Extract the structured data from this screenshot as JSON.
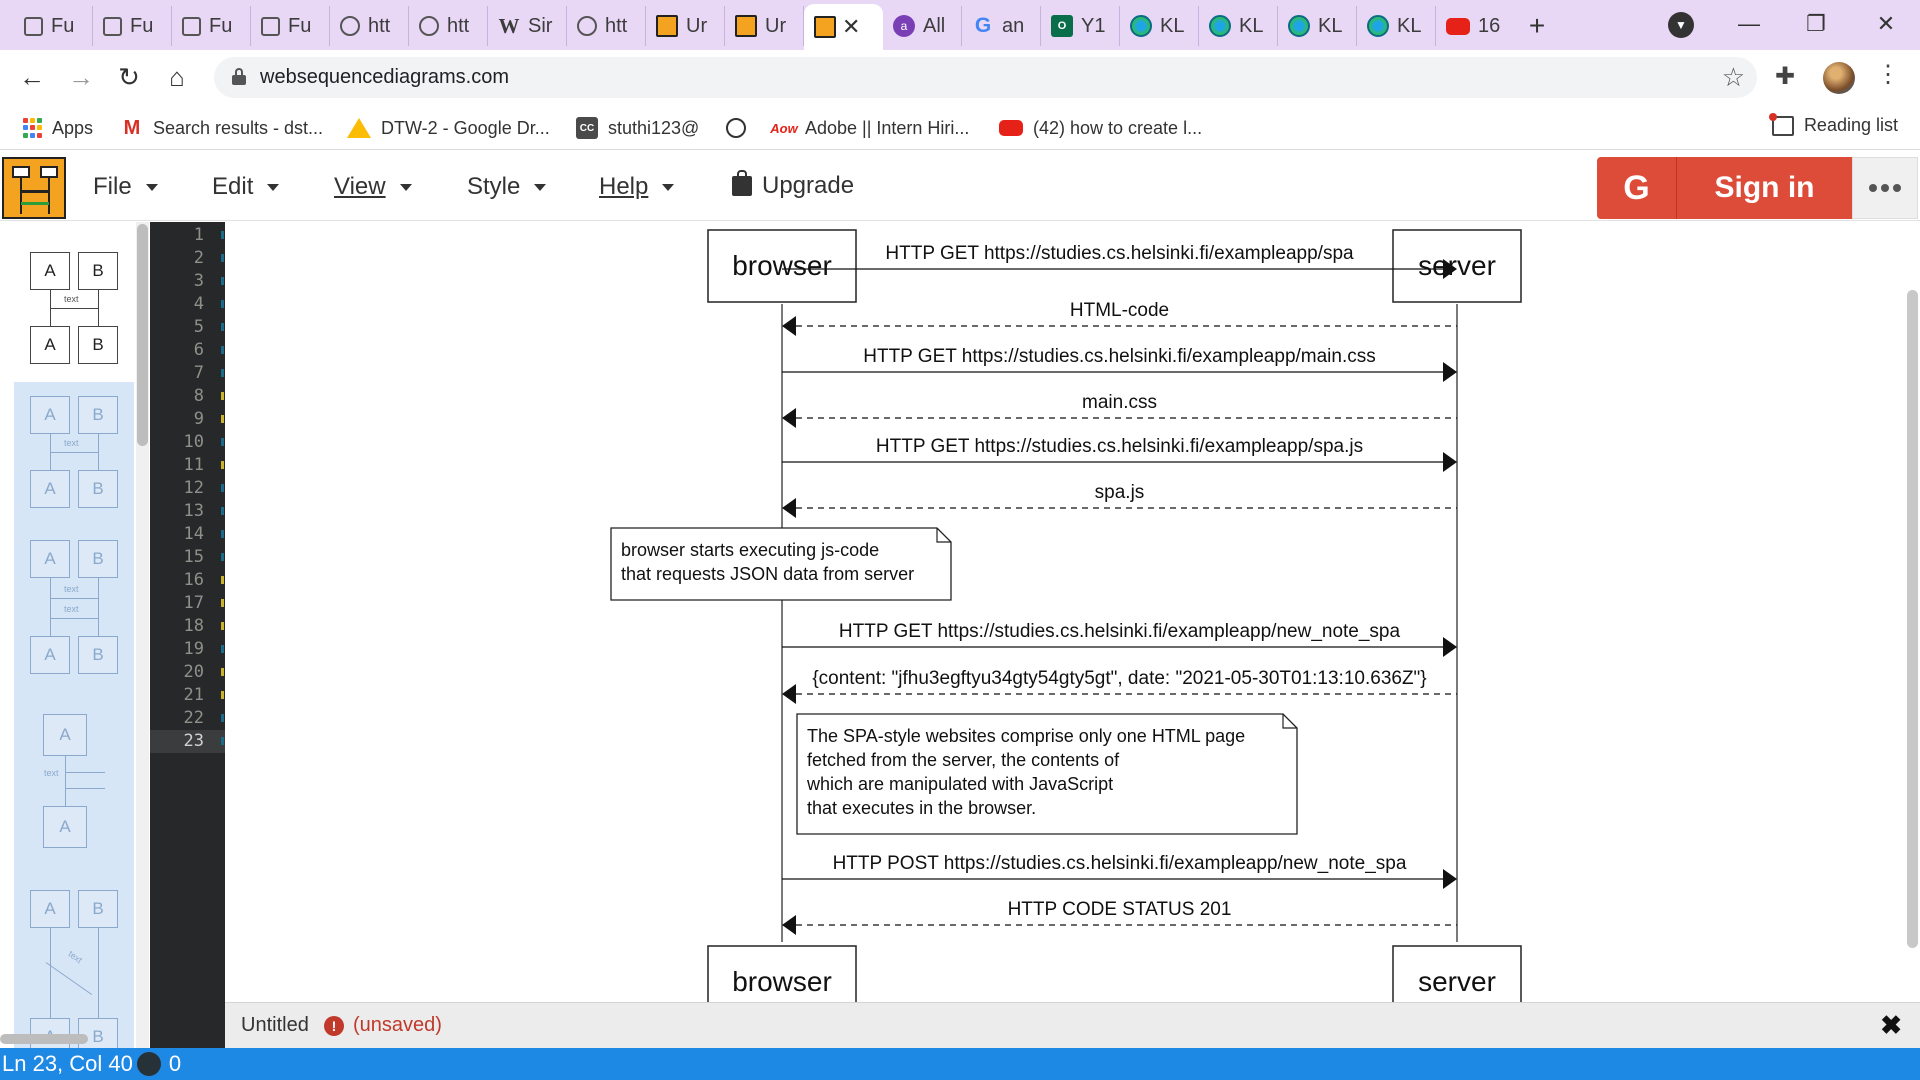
{
  "browser": {
    "tabs": [
      {
        "icon": "page-icon",
        "title": "Fu"
      },
      {
        "icon": "page-icon",
        "title": "Fu"
      },
      {
        "icon": "page-icon",
        "title": "Fu"
      },
      {
        "icon": "page-icon",
        "title": "Fu"
      },
      {
        "icon": "globe-icon",
        "title": "htt"
      },
      {
        "icon": "globe-icon",
        "title": "htt"
      },
      {
        "icon": "wikipedia-icon",
        "title": "Sir"
      },
      {
        "icon": "globe-icon",
        "title": "htt"
      },
      {
        "icon": "websequencediagrams-icon",
        "title": "Ur"
      },
      {
        "icon": "websequencediagrams-icon",
        "title": "Ur"
      },
      {
        "icon": "websequencediagrams-icon",
        "title": "",
        "active": true
      },
      {
        "icon": "assistant-icon",
        "title": "All"
      },
      {
        "icon": "google-icon",
        "title": "an"
      },
      {
        "icon": "outlook-icon",
        "title": "Y1"
      },
      {
        "icon": "kl-icon",
        "title": "KL"
      },
      {
        "icon": "kl-icon",
        "title": "KL"
      },
      {
        "icon": "kl-icon",
        "title": "KL"
      },
      {
        "icon": "kl-icon",
        "title": "KL"
      },
      {
        "icon": "youtube-icon",
        "title": "16"
      }
    ],
    "url": "websequencediagrams.com",
    "bookmarks": [
      {
        "icon": "apps-icon",
        "label": "Apps"
      },
      {
        "icon": "gmail-icon",
        "label": "Search results - dst..."
      },
      {
        "icon": "drive-icon",
        "label": "DTW-2 - Google Dr..."
      },
      {
        "icon": "cc-icon",
        "label": "stuthi123@"
      },
      {
        "icon": "globe-icon",
        "label": ""
      },
      {
        "icon": "adobe-icon",
        "label": "Adobe || Intern Hiri..."
      },
      {
        "icon": "youtube-icon",
        "label": "(42) how to create l..."
      }
    ],
    "reading_list": "Reading list"
  },
  "app": {
    "menus": [
      "File",
      "Edit",
      "View",
      "Style",
      "Help"
    ],
    "upgrade": "Upgrade",
    "sign_in": "Sign in",
    "google_glyph": "G"
  },
  "palette": {
    "box_a": "A",
    "box_b": "B",
    "arrow_text": "text"
  },
  "editor": {
    "line_count": 23,
    "current_line": 23
  },
  "diagram": {
    "participants": [
      "browser",
      "server"
    ],
    "messages": [
      {
        "text": "HTTP GET https://studies.cs.helsinki.fi/exampleapp/spa",
        "dir": "right",
        "dashed": false
      },
      {
        "text": "HTML-code",
        "dir": "left",
        "dashed": true
      },
      {
        "text": "HTTP GET https://studies.cs.helsinki.fi/exampleapp/main.css",
        "dir": "right",
        "dashed": false
      },
      {
        "text": "main.css",
        "dir": "left",
        "dashed": true
      },
      {
        "text": "HTTP GET https://studies.cs.helsinki.fi/exampleapp/spa.js",
        "dir": "right",
        "dashed": false
      },
      {
        "text": "spa.js",
        "dir": "left",
        "dashed": true
      },
      {
        "text": "HTTP GET https://studies.cs.helsinki.fi/exampleapp/new_note_spa",
        "dir": "right",
        "dashed": false
      },
      {
        "text": "{content: \"jfhu3egftyu34gty54gty5gt\", date: \"2021-05-30T01:13:10.636Z\"}",
        "dir": "left",
        "dashed": true
      },
      {
        "text": "HTTP POST https://studies.cs.helsinki.fi/exampleapp/new_note_spa",
        "dir": "right",
        "dashed": false
      },
      {
        "text": "HTTP CODE STATUS 201",
        "dir": "left",
        "dashed": true
      }
    ],
    "notes": [
      {
        "lines": [
          "browser starts executing js-code",
          "that requests JSON data from server"
        ]
      },
      {
        "lines": [
          "The SPA-style websites comprise only one HTML page",
          "fetched from the server, the contents of",
          "which are manipulated with JavaScript",
          "that executes in the browser."
        ]
      }
    ]
  },
  "document": {
    "name": "Untitled",
    "status": "(unsaved)",
    "warning_glyph": "!"
  },
  "status_bar": {
    "position": "Ln 23, Col 40",
    "count": "0"
  }
}
